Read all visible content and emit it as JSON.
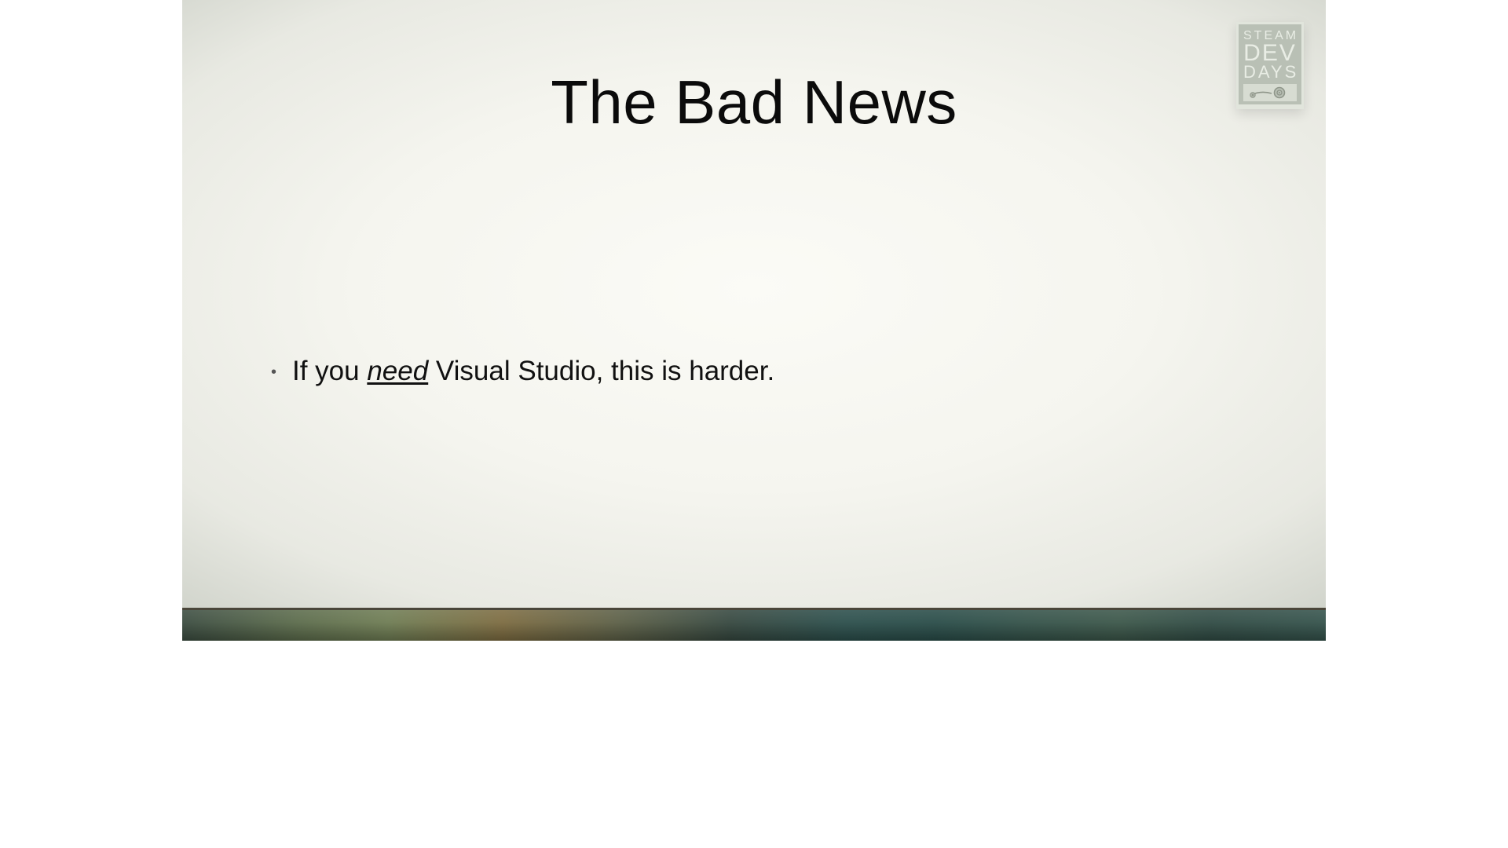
{
  "slide": {
    "title": "The Bad News",
    "bullets": [
      {
        "before": "If you ",
        "emph": "need",
        "after": " Visual Studio, this is harder."
      }
    ]
  },
  "logo": {
    "line1": "STEAM",
    "line2": "DEV",
    "line3": "DAYS",
    "icon_name": "steam-icon"
  }
}
